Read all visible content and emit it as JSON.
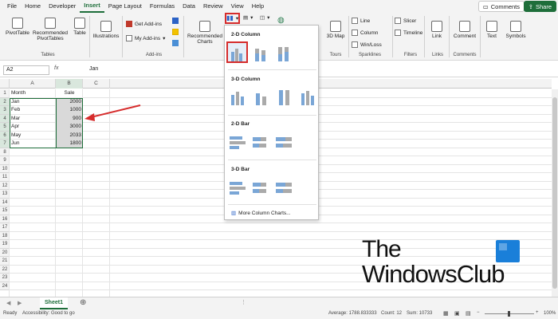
{
  "menu": {
    "tabs": [
      "File",
      "Home",
      "Developer",
      "Insert",
      "Page Layout",
      "Formulas",
      "Data",
      "Review",
      "View",
      "Help"
    ],
    "comments": "Comments",
    "share": "Share"
  },
  "ribbon": {
    "pivottable": "PivotTable",
    "rec_pivot": "Recommended PivotTables",
    "table": "Table",
    "illustrations": "Illustrations",
    "get_addins": "Get Add-ins",
    "my_addins": "My Add-ins",
    "rec_charts": "Recommended Charts",
    "map3d": "3D Map",
    "line": "Line",
    "column": "Column",
    "winloss": "Win/Loss",
    "slicer": "Slicer",
    "timeline": "Timeline",
    "link": "Link",
    "comment": "Comment",
    "text": "Text",
    "symbols": "Symbols",
    "groups": {
      "tables": "Tables",
      "addins": "Add-ins",
      "tours": "Tours",
      "sparklines": "Sparklines",
      "filters": "Filters",
      "links": "Links",
      "comments": "Comments"
    }
  },
  "formula": {
    "namebox": "A2",
    "fx": "fx",
    "value": "Jan"
  },
  "columns": [
    "A",
    "B",
    "C"
  ],
  "rows": [
    "1",
    "2",
    "3",
    "4",
    "5",
    "6",
    "7",
    "8",
    "9",
    "10",
    "11",
    "12",
    "13",
    "14",
    "15",
    "16",
    "17",
    "18",
    "19",
    "20",
    "21",
    "22",
    "23",
    "24"
  ],
  "table": {
    "headers": [
      "Month",
      "Sale"
    ],
    "data": [
      [
        "Jan",
        "2000"
      ],
      [
        "Feb",
        "1000"
      ],
      [
        "Mar",
        "900"
      ],
      [
        "Apr",
        "3000"
      ],
      [
        "May",
        "2033"
      ],
      [
        "Jun",
        "1800"
      ]
    ]
  },
  "dropdown": {
    "sec1": "2-D Column",
    "sec2": "3-D Column",
    "sec3": "2-D Bar",
    "sec4": "3-D Bar",
    "more": "More Column Charts..."
  },
  "sheet": {
    "name": "Sheet1"
  },
  "status": {
    "ready": "Ready",
    "accessibility": "Accessibility: Good to go",
    "average": "Average: 1788.833333",
    "count": "Count: 12",
    "sum": "Sum: 10733",
    "zoom": "100%"
  },
  "logo": {
    "line1": "The",
    "line2": "WindowsClub"
  }
}
